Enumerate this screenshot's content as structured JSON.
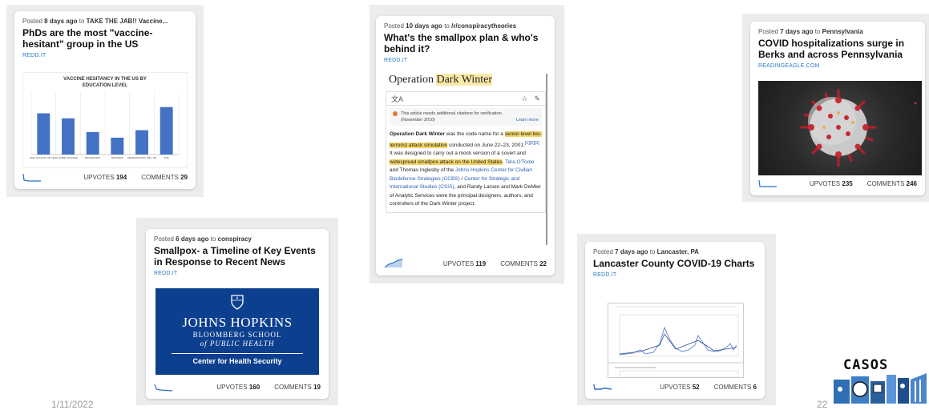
{
  "cards": {
    "c1": {
      "posted_prefix": "Posted",
      "ago": "8 days ago",
      "to": "to",
      "community": "TAKE THE JAB!! Vaccine...",
      "title": "PhDs are the most \"vaccine-hesitant\" group in the US",
      "source": "REDD.IT",
      "upvotes_label": "UPVOTES",
      "upvotes": "194",
      "comments_label": "COMMENTS",
      "comments": "29"
    },
    "c2": {
      "posted_prefix": "Posted",
      "ago": "6 days ago",
      "to": "to",
      "community": "conspiracy",
      "title": "Smallpox- a Timeline of Key Events in Response to Recent News",
      "source": "REDD.IT",
      "upvotes_label": "UPVOTES",
      "upvotes": "160",
      "comments_label": "COMMENTS",
      "comments": "19"
    },
    "c3": {
      "posted_prefix": "Posted",
      "ago": "10 days ago",
      "to": "to",
      "community": "/r/conspiracytheories",
      "title": "What's the smallpox plan & who's behind it?",
      "source": "REDD.IT",
      "upvotes_label": "UPVOTES",
      "upvotes": "119",
      "comments_label": "COMMENTS",
      "comments": "22"
    },
    "c4": {
      "posted_prefix": "Posted",
      "ago": "7 days ago",
      "to": "to",
      "community": "Lancaster, PA",
      "title": "Lancaster County COVID-19 Charts",
      "source": "REDD.IT",
      "upvotes_label": "UPVOTES",
      "upvotes": "52",
      "comments_label": "COMMENTS",
      "comments": "6"
    },
    "c5": {
      "posted_prefix": "Posted",
      "ago": "7 days ago",
      "to": "to",
      "community": "Pennsylvania",
      "title": "COVID hospitalizations surge in Berks and across Pennsylvania",
      "source": "READINGEAGLE.COM",
      "upvotes_label": "UPVOTES",
      "upvotes": "235",
      "comments_label": "COMMENTS",
      "comments": "246"
    }
  },
  "chart_data": {
    "type": "bar",
    "title": "VACCINE HESITANCY IN THE US BY EDUCATION LEVEL",
    "categories": [
      "HIGH SCHOOL OR LESS",
      "SOME COLLEGE",
      "BACHELOR'S",
      "MASTERS",
      "PROFESSIONAL (MD, JD)",
      "PHD"
    ],
    "values": [
      0.66,
      0.58,
      0.36,
      0.27,
      0.39,
      0.76
    ],
    "ylim": [
      0,
      1
    ],
    "bar_color": "#4472c4",
    "grid": true
  },
  "wiki": {
    "heading_plain": "Operation ",
    "heading_hl": "Dark Winter",
    "notice": "This article needs additional citations for verification.",
    "notice_date": "(November 2010)",
    "learn_more": "Learn more",
    "p_bold": "Operation Dark Winter",
    "p1": " was the code name for a ",
    "p_hl1": "senior-level bio-terrorist attack simulation",
    "p2": " conducted on June 22–23, 2001.",
    "p_refs": "[1][2][3]",
    "p3": " It was designed to carry out a mock version of a covert and ",
    "p_hl2": "widespread smallpox attack on the United States",
    "p4": ". ",
    "p_link1": "Tara O'Toole",
    "p5": " and Thomas Inglesby of the ",
    "p_link2": "Johns Hopkins Center for Civilian Biodefense Strategies (CCBS)",
    "p6": " / ",
    "p_link3": "Center for Strategic and International Studies (CSIS)",
    "p7": ", and Randy Larsen and Mark DeMier of Analytic Services were the principal designers, authors, and controllers of the Dark Winter project."
  },
  "jhu": {
    "name": "JOHNS HOPKINS",
    "school1": "BLOOMBERG SCHOOL",
    "school2": "of PUBLIC HEALTH",
    "center": "Center for Health Security"
  },
  "footer": {
    "date": "1/11/2022",
    "page": "22",
    "logo_text": "CASOS"
  },
  "colors": {
    "accent_link": "#2a78c8",
    "panel": "#ececec",
    "jhu_blue": "#0d3f8f",
    "highlight": "#f6d66a"
  },
  "icons": [
    "translate-icon",
    "star-icon",
    "pencil-icon",
    "warning-icon",
    "sparkline-icon",
    "virus-image",
    "jhu-shield-icon",
    "casos-logo"
  ]
}
